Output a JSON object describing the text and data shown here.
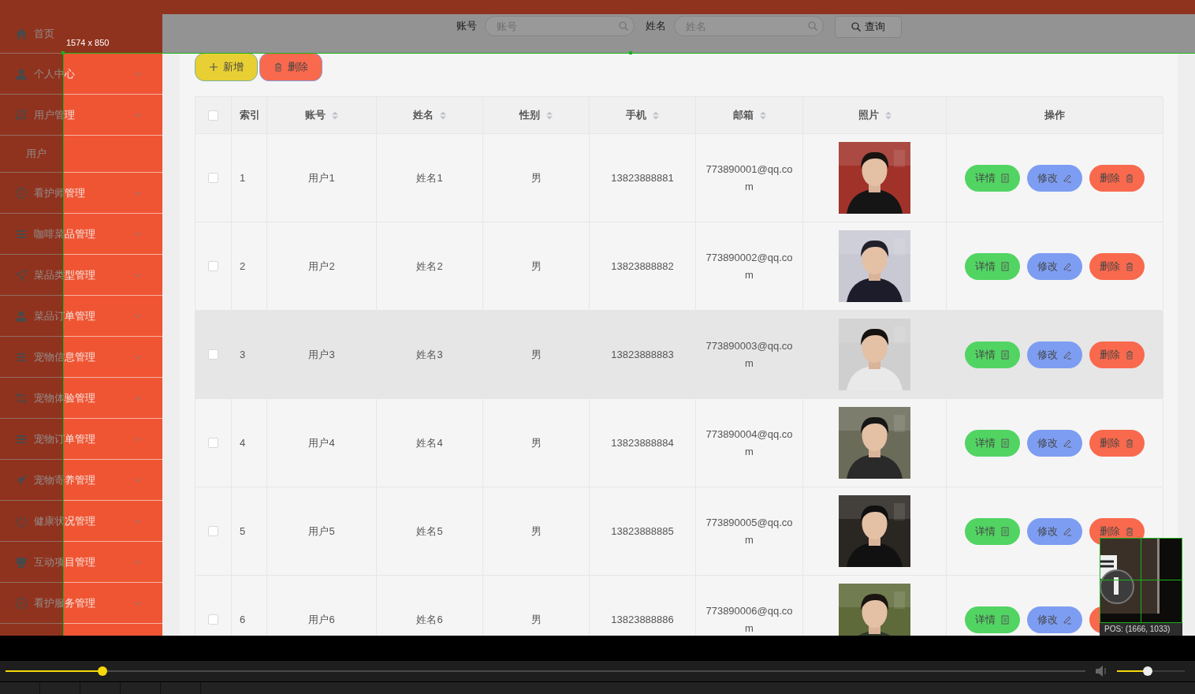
{
  "screenshot_tool": {
    "size_label": "1574 x 850",
    "position_label": "POS: (1666, 1033)"
  },
  "sidebar": {
    "items": [
      {
        "kind": "link",
        "label": "首页"
      },
      {
        "kind": "menu",
        "label": "个人中心",
        "expanded": false
      },
      {
        "kind": "menu",
        "label": "用户管理",
        "expanded": true,
        "children": [
          {
            "label": "用户"
          }
        ]
      },
      {
        "kind": "menu",
        "label": "看护师管理",
        "expanded": false
      },
      {
        "kind": "menu",
        "label": "咖啡菜品管理",
        "expanded": false
      },
      {
        "kind": "menu",
        "label": "菜品类型管理",
        "expanded": false
      },
      {
        "kind": "menu",
        "label": "菜品订单管理",
        "expanded": false
      },
      {
        "kind": "menu",
        "label": "宠物信息管理",
        "expanded": false
      },
      {
        "kind": "menu",
        "label": "宠物体验管理",
        "expanded": false
      },
      {
        "kind": "menu",
        "label": "宠物订单管理",
        "expanded": false
      },
      {
        "kind": "menu",
        "label": "宠物寄养管理",
        "expanded": false
      },
      {
        "kind": "menu",
        "label": "健康状况管理",
        "expanded": false
      },
      {
        "kind": "menu",
        "label": "互动项目管理",
        "expanded": false
      },
      {
        "kind": "menu",
        "label": "看护服务管理",
        "expanded": false
      }
    ]
  },
  "search": {
    "fields": [
      {
        "label": "账号",
        "placeholder": "账号"
      },
      {
        "label": "姓名",
        "placeholder": "姓名"
      }
    ],
    "button": "查询"
  },
  "toolbar": {
    "buttons": [
      {
        "kind": "add",
        "label": "新增"
      },
      {
        "kind": "delete",
        "label": "删除"
      }
    ]
  },
  "table": {
    "select_all": {
      "checked": false
    },
    "columns": [
      {
        "label": "索引",
        "sortable": false
      },
      {
        "label": "账号",
        "sortable": true
      },
      {
        "label": "姓名",
        "sortable": true
      },
      {
        "label": "性别",
        "sortable": true
      },
      {
        "label": "手机",
        "sortable": true
      },
      {
        "label": "邮箱",
        "sortable": true
      },
      {
        "label": "照片",
        "sortable": true
      },
      {
        "label": "操作",
        "sortable": false
      }
    ],
    "rows": [
      {
        "checked": false,
        "highlighted": false,
        "cells": [
          "1",
          "用户1",
          "姓名1",
          "男",
          "13823888881",
          "773890001@qq.com"
        ],
        "actions": [
          {
            "kind": "detail",
            "label": "详情"
          },
          {
            "kind": "edit",
            "label": "修改"
          },
          {
            "kind": "delete",
            "label": "删除"
          }
        ]
      },
      {
        "checked": false,
        "highlighted": false,
        "cells": [
          "2",
          "用户2",
          "姓名2",
          "男",
          "13823888882",
          "773890002@qq.com"
        ],
        "actions": [
          {
            "kind": "detail",
            "label": "详情"
          },
          {
            "kind": "edit",
            "label": "修改"
          },
          {
            "kind": "delete",
            "label": "删除"
          }
        ]
      },
      {
        "checked": false,
        "highlighted": true,
        "cells": [
          "3",
          "用户3",
          "姓名3",
          "男",
          "13823888883",
          "773890003@qq.com"
        ],
        "actions": [
          {
            "kind": "detail",
            "label": "详情"
          },
          {
            "kind": "edit",
            "label": "修改"
          },
          {
            "kind": "delete",
            "label": "删除"
          }
        ]
      },
      {
        "checked": false,
        "highlighted": false,
        "cells": [
          "4",
          "用户4",
          "姓名4",
          "男",
          "13823888884",
          "773890004@qq.com"
        ],
        "actions": [
          {
            "kind": "detail",
            "label": "详情"
          },
          {
            "kind": "edit",
            "label": "修改"
          },
          {
            "kind": "delete",
            "label": "删除"
          }
        ]
      },
      {
        "checked": false,
        "highlighted": false,
        "cells": [
          "5",
          "用户5",
          "姓名5",
          "男",
          "13823888885",
          "773890005@qq.com"
        ],
        "actions": [
          {
            "kind": "detail",
            "label": "详情"
          },
          {
            "kind": "edit",
            "label": "修改"
          },
          {
            "kind": "delete",
            "label": "删除"
          }
        ]
      },
      {
        "checked": false,
        "highlighted": false,
        "cells": [
          "6",
          "用户6",
          "姓名6",
          "男",
          "13823888886",
          "773890006@qq.com"
        ],
        "actions": [
          {
            "kind": "detail",
            "label": "详情"
          },
          {
            "kind": "edit",
            "label": "修改"
          },
          {
            "kind": "delete"
          }
        ]
      }
    ]
  },
  "player": {
    "progress": {
      "level": 0.09
    },
    "volume": {
      "level": 0.45
    }
  }
}
